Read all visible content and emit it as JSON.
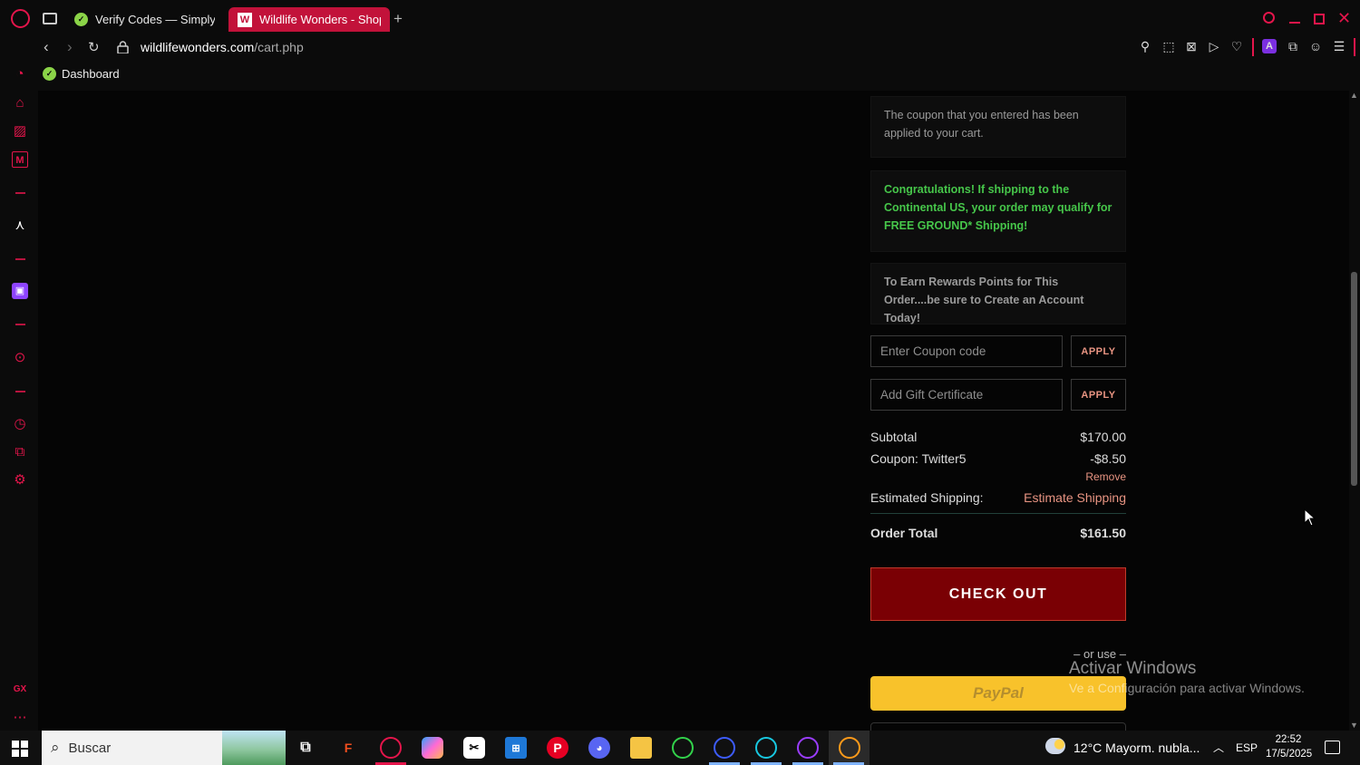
{
  "browser": {
    "tabs": [
      {
        "label": "Verify Codes — SimplyCo",
        "active": false
      },
      {
        "label": "Wildlife Wonders - Shopp",
        "active": true
      }
    ],
    "url_domain": "wildlifewonders.com",
    "url_path": "/cart.php",
    "bookmark": "Dashboard",
    "accent": "#e4154b"
  },
  "notices": {
    "coupon_applied": "The coupon that you entered has been applied to your cart.",
    "free_shipping": "Congratulations! If shipping to the Continental US, your order may qualify for FREE GROUND* Shipping!",
    "rewards": "To Earn Rewards Points for This Order....be sure to Create an Account Today!"
  },
  "coupon": {
    "placeholder": "Enter Coupon code",
    "apply_label": "APPLY"
  },
  "gift": {
    "placeholder": "Add Gift Certificate",
    "apply_label": "APPLY"
  },
  "totals": {
    "subtotal_label": "Subtotal",
    "subtotal": "$170.00",
    "coupon_label": "Coupon: Twitter5",
    "coupon_value": "-$8.50",
    "remove_label": "Remove",
    "shipping_label": "Estimated Shipping:",
    "shipping_link": "Estimate Shipping",
    "total_label": "Order Total",
    "total": "$161.50"
  },
  "checkout_label": "CHECK OUT",
  "or_use": "– or use –",
  "paypal_label": "PayPal",
  "watermark": {
    "title": "Activar Windows",
    "subtitle": "Ve a Configuración para activar Windows."
  },
  "taskbar": {
    "search_placeholder": "Buscar",
    "weather": "12°C  Mayorm. nubla...",
    "lang": "ESP",
    "time": "22:52",
    "date": "17/5/2025"
  }
}
